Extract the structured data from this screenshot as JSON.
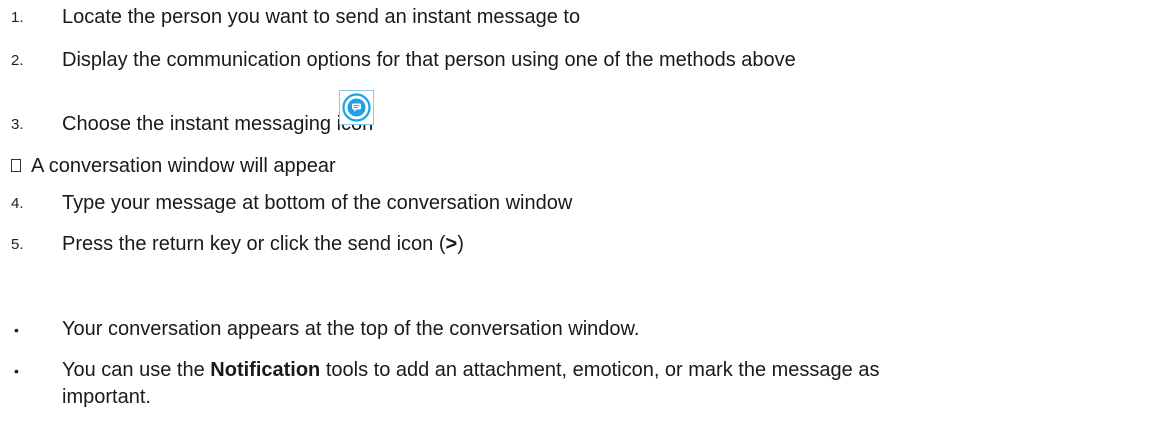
{
  "steps_part1": [
    {
      "number": "1.",
      "text": "Locate the person you want to send an instant message to"
    },
    {
      "number": "2.",
      "text": "Display the communication options for that person using one of the methods above"
    },
    {
      "number": "3.",
      "text": "Choose the instant messaging icon"
    }
  ],
  "icons": {
    "instant_message": "chat-bubble-icon",
    "box_marker": "empty-square-marker-icon",
    "accent_color": "#1ea1e6"
  },
  "note": {
    "text": "A conversation window will appear"
  },
  "steps_part2": [
    {
      "number": "4.",
      "text": "Type your message at bottom of the conversation window"
    },
    {
      "number": "5.",
      "text_before": "Press the return key or click the send icon (",
      "bold": ">",
      "text_after": ")"
    }
  ],
  "bullets": [
    {
      "text": "Your conversation appears at the top of the conversation window."
    },
    {
      "text_before": "You can use the ",
      "bold": "Notification",
      "text_after": " tools to add an attachment, emoticon, or mark the message as",
      "continuation": "important."
    }
  ],
  "bullet_symbol": "•"
}
